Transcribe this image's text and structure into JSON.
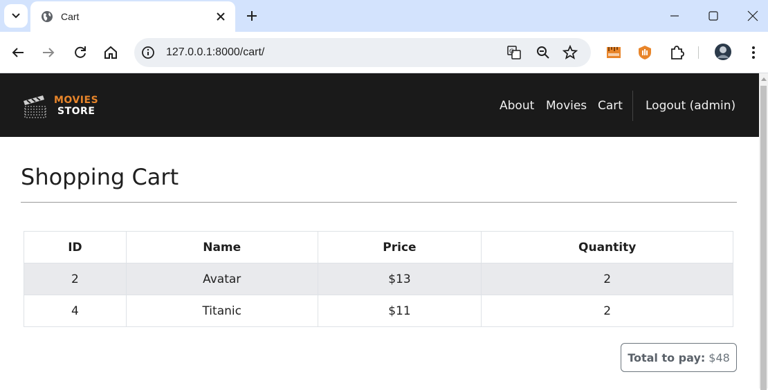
{
  "browser": {
    "tab_title": "Cart",
    "url": "127.0.0.1:8000/cart/"
  },
  "site": {
    "logo_top": "MOVIES",
    "logo_bottom": "STORE",
    "nav": {
      "about": "About",
      "movies": "Movies",
      "cart": "Cart",
      "logout": "Logout (admin)"
    }
  },
  "page": {
    "heading": "Shopping Cart",
    "table": {
      "headers": [
        "ID",
        "Name",
        "Price",
        "Quantity"
      ],
      "rows": [
        {
          "id": "2",
          "name": "Avatar",
          "price": "$13",
          "quantity": "2"
        },
        {
          "id": "4",
          "name": "Titanic",
          "price": "$11",
          "quantity": "2"
        }
      ]
    },
    "total_label": "Total to pay:",
    "total_value": "$48"
  },
  "colors": {
    "nav_background": "#1a1a1a",
    "logo_accent": "#e8852a",
    "tab_strip": "#d3e3fd",
    "striped_row": "#e9eaed"
  },
  "icons": [
    "tab-search-icon",
    "globe-icon",
    "close-icon",
    "plus-icon",
    "minimize-icon",
    "maximize-icon",
    "window-close-icon",
    "back-arrow-icon",
    "forward-arrow-icon",
    "reload-icon",
    "home-icon",
    "site-info-icon",
    "translate-icon",
    "zoom-out-icon",
    "bookmark-star-icon",
    "extension-ruler-icon",
    "extension-shield-icon",
    "extensions-puzzle-icon",
    "profile-avatar",
    "more-menu-icon",
    "clapperboard-icon"
  ]
}
